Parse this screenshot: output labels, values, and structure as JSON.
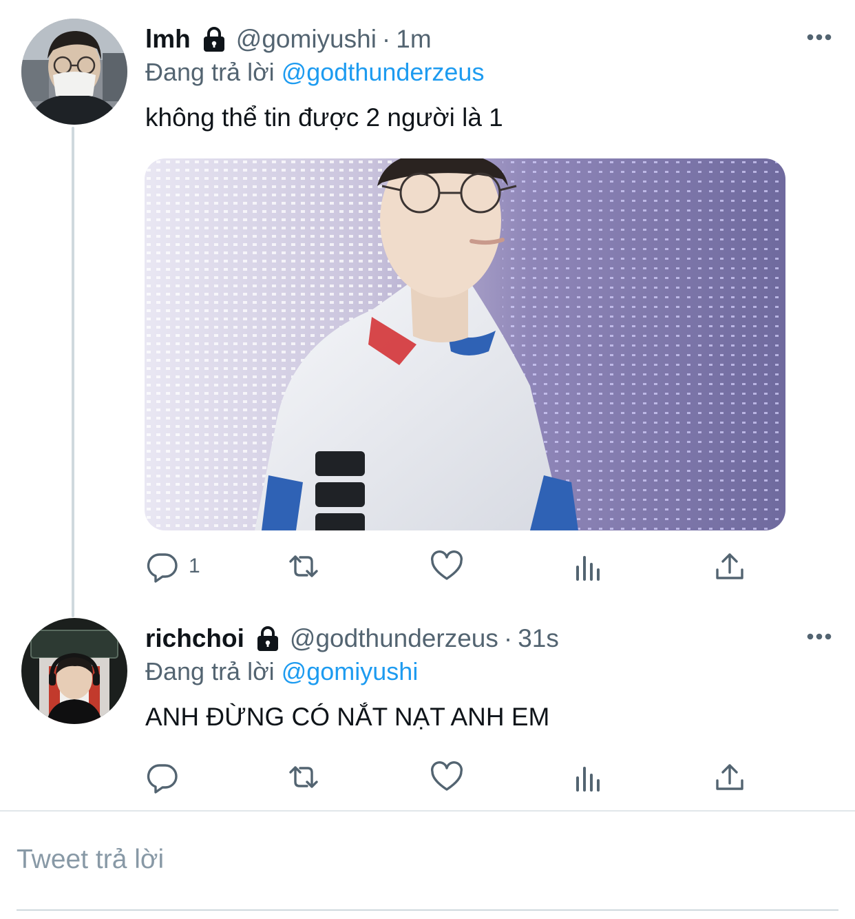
{
  "tweets": [
    {
      "display_name": "lmh",
      "handle": "@gomiyushi",
      "separator": "·",
      "timestamp": "1m",
      "replying_prefix": "Đang trả lời",
      "replying_to": "@godthunderzeus",
      "text": "không thể tin được 2 người là 1",
      "has_media": true,
      "reply_count": "1",
      "icons": [
        "lock-icon",
        "more-icon",
        "reply-icon",
        "retweet-icon",
        "like-icon",
        "views-icon",
        "share-icon"
      ]
    },
    {
      "display_name": "richchoi",
      "handle": "@godthunderzeus",
      "separator": "·",
      "timestamp": "31s",
      "replying_prefix": "Đang trả lời",
      "replying_to": "@gomiyushi",
      "text": "ANH ĐỪNG CÓ NẮT NẠT ANH EM",
      "has_media": false,
      "reply_count": "",
      "icons": [
        "lock-icon",
        "more-icon",
        "reply-icon",
        "retweet-icon",
        "like-icon",
        "views-icon",
        "share-icon"
      ]
    }
  ],
  "composer": {
    "placeholder": "Tweet trả lời"
  },
  "colors": {
    "text": "#0f1419",
    "secondary": "#536471",
    "link": "#1d9bf0",
    "thread_line": "#cfd9de"
  }
}
